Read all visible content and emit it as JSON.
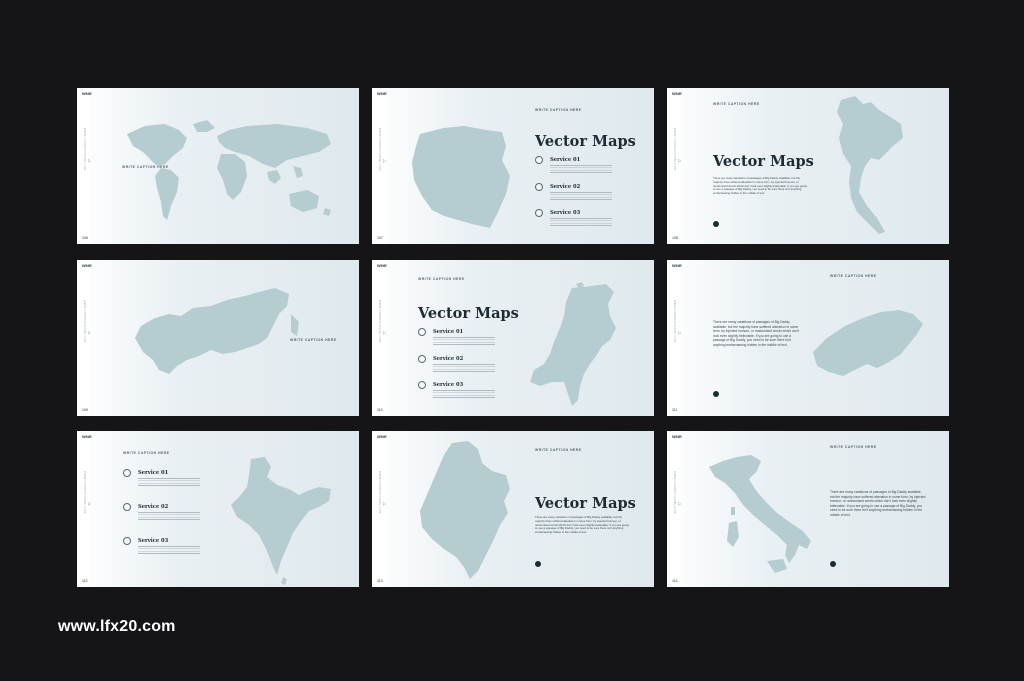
{
  "brand": "WNE",
  "caption": "WRITE CAPTION HERE",
  "title": "Vector Maps",
  "vertical_text": "WWW.COMPANYNAME.COM",
  "services": [
    "Service 01",
    "Service 02",
    "Service 03"
  ],
  "service_text": "There are many variations of passages of Big Daddy available, but the majority have suffered alteration in some form, by injected humour.",
  "paragraph": "There are many variations of passages of Big Daddy available, but the majority have suffered alteration in some form, by injected humour, or randomised words which don't look even slightly believable. If you are going to use a passage of Big Daddy, you need to be sure there isn't anything embarrassing hidden in the middle of text.",
  "page_numbers": [
    "106",
    "107",
    "108",
    "109",
    "110",
    "111",
    "112",
    "113",
    "114"
  ],
  "slides": [
    {
      "name": "world-map-slide",
      "map": "world"
    },
    {
      "name": "poland-map-slide",
      "map": "poland"
    },
    {
      "name": "thailand-map-slide",
      "map": "thailand"
    },
    {
      "name": "russia-map-slide",
      "map": "russia"
    },
    {
      "name": "netherlands-map-slide",
      "map": "netherlands"
    },
    {
      "name": "switzerland-map-slide",
      "map": "switzerland"
    },
    {
      "name": "india-map-slide",
      "map": "india"
    },
    {
      "name": "colombia-map-slide",
      "map": "colombia"
    },
    {
      "name": "italy-map-slide",
      "map": "italy"
    }
  ],
  "colors": {
    "background": "#151517",
    "map_fill": "#b5ccd1",
    "text_dark": "#1d2b33"
  },
  "watermark": "www.lfx20.com"
}
